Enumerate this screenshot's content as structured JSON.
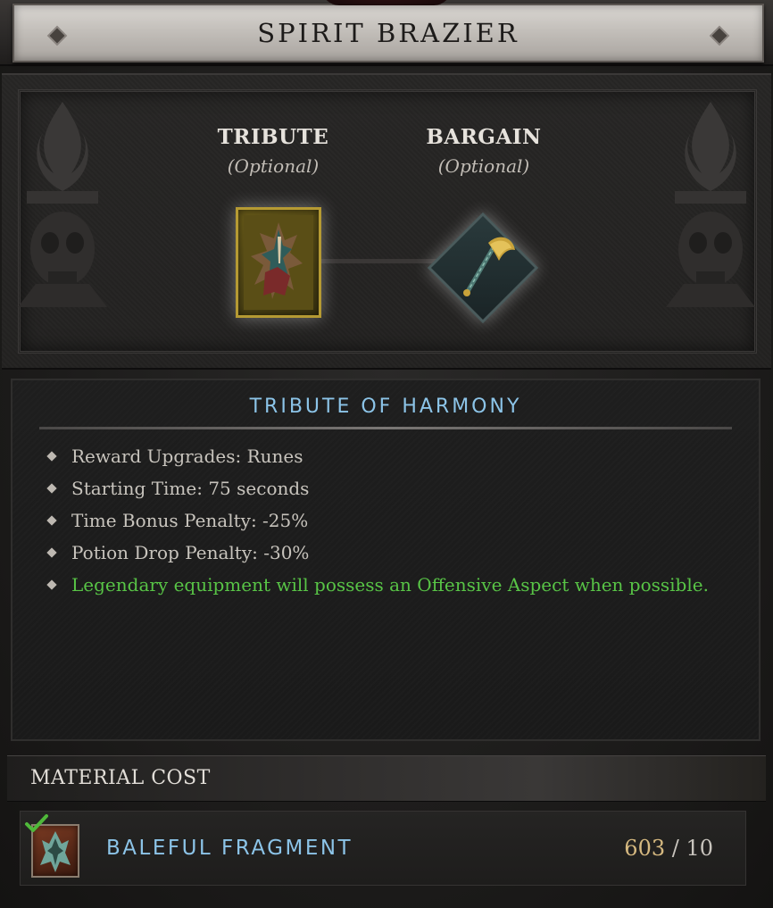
{
  "header": {
    "title": "SPIRIT BRAZIER"
  },
  "slots": {
    "tribute": {
      "title": "TRIBUTE",
      "subtitle": "(Optional)",
      "item_icon": "tribute-of-harmony-icon"
    },
    "bargain": {
      "title": "BARGAIN",
      "subtitle": "(Optional)",
      "item_icon": "axe-icon"
    }
  },
  "details": {
    "title": "TRIBUTE OF HARMONY",
    "effects": [
      {
        "text": "Reward Upgrades: Runes",
        "type": "normal"
      },
      {
        "text": "Starting Time: 75 seconds",
        "type": "normal"
      },
      {
        "text": "Time Bonus Penalty: -25%",
        "type": "normal"
      },
      {
        "text": "Potion Drop Penalty: -30%",
        "type": "normal"
      },
      {
        "text": "Legendary equipment will possess an Offensive Aspect when possible.",
        "type": "legendary"
      }
    ]
  },
  "material_cost": {
    "title": "MATERIAL COST",
    "item": {
      "name": "BALEFUL FRAGMENT",
      "have": "603",
      "separator": " / ",
      "need": "10",
      "icon": "baleful-fragment-icon",
      "status_icon": "check-icon"
    }
  },
  "colors": {
    "accent_blue": "#8cc4e8",
    "legendary_green": "#58c446",
    "owned_qty": "#d6b980",
    "check_green": "#4fb83a"
  }
}
